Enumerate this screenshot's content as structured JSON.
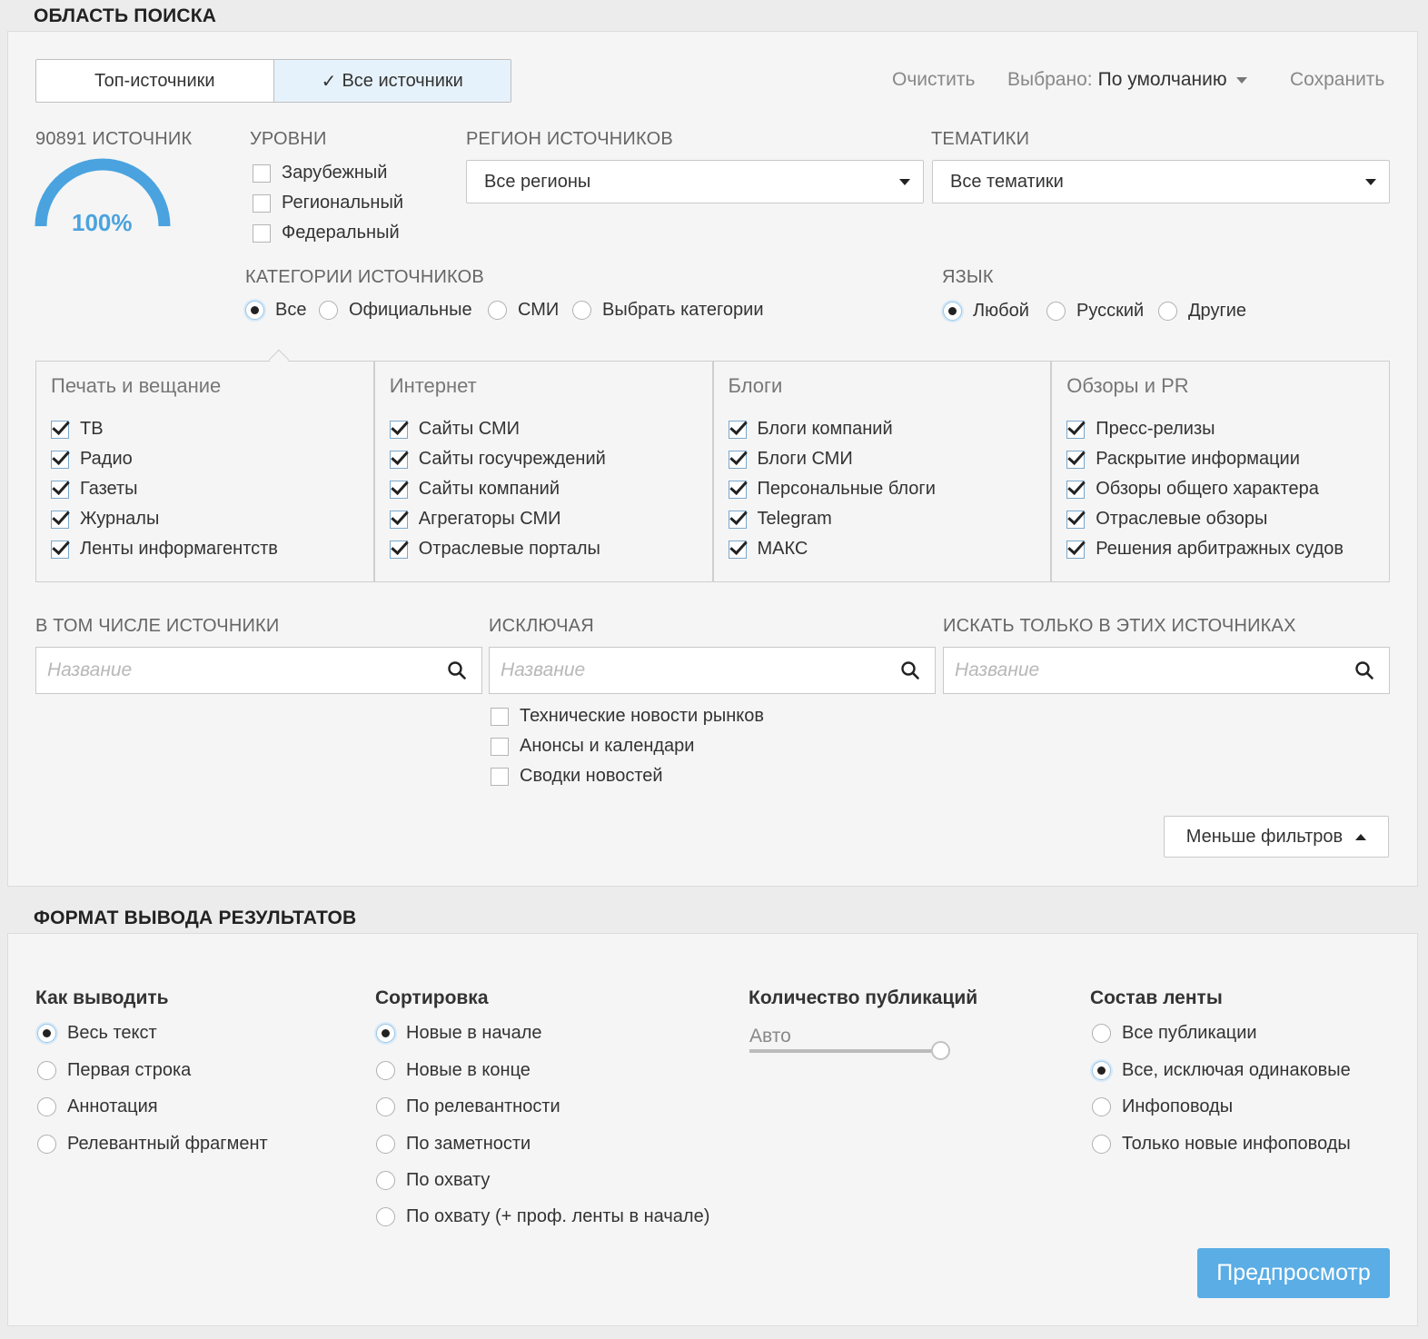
{
  "search_area": {
    "title": "ОБЛАСТЬ ПОИСКА",
    "segmented": {
      "top_sources": "Топ-источники",
      "all_sources": "Все источники"
    },
    "top_actions": {
      "clear": "Очистить",
      "selected_label": "Выбрано:",
      "selected_value": "По умолчанию",
      "save": "Сохранить"
    },
    "gauge": {
      "label": "90891 ИСТОЧНИК",
      "percent_text": "100%",
      "percent": 100,
      "color": "#4aa3df"
    },
    "levels": {
      "label": "УРОВНИ",
      "items": [
        "Зарубежный",
        "Региональный",
        "Федеральный"
      ]
    },
    "region": {
      "label": "РЕГИОН ИСТОЧНИКОВ",
      "value": "Все регионы"
    },
    "topics": {
      "label": "ТЕМАТИКИ",
      "value": "Все тематики"
    },
    "source_categories": {
      "label": "КАТЕГОРИИ ИСТОЧНИКОВ",
      "options": [
        "Все",
        "Официальные",
        "СМИ",
        "Выбрать категории"
      ],
      "selected": "Все"
    },
    "language": {
      "label": "ЯЗЫК",
      "options": [
        "Любой",
        "Русский",
        "Другие"
      ],
      "selected": "Любой"
    },
    "category_groups": [
      {
        "title": "Печать и вещание",
        "items": [
          "ТВ",
          "Радио",
          "Газеты",
          "Журналы",
          "Ленты информагентств"
        ]
      },
      {
        "title": "Интернет",
        "items": [
          "Сайты СМИ",
          "Сайты госучреждений",
          "Сайты компаний",
          "Агрегаторы СМИ",
          "Отраслевые порталы"
        ]
      },
      {
        "title": "Блоги",
        "items": [
          "Блоги компаний",
          "Блоги СМИ",
          "Персональные блоги",
          "Telegram",
          "МАКС"
        ]
      },
      {
        "title": "Обзоры и PR",
        "items": [
          "Пресс-релизы",
          "Раскрытие информации",
          "Обзоры общего характера",
          "Отраслевые обзоры",
          "Решения арбитражных судов"
        ]
      }
    ],
    "include_sources": {
      "label": "В ТОМ ЧИСЛЕ ИСТОЧНИКИ",
      "placeholder": "Название"
    },
    "exclude": {
      "label": "ИСКЛЮЧАЯ",
      "placeholder": "Название",
      "options": [
        "Технические новости рынков",
        "Анонсы и календари",
        "Сводки новостей"
      ]
    },
    "only_sources": {
      "label": "ИСКАТЬ ТОЛЬКО В ЭТИХ ИСТОЧНИКАХ",
      "placeholder": "Название"
    },
    "fewer_filters": "Меньше фильтров"
  },
  "output_format": {
    "title": "ФОРМАТ ВЫВОДА РЕЗУЛЬТАТОВ",
    "how": {
      "label": "Как выводить",
      "options": [
        "Весь текст",
        "Первая строка",
        "Аннотация",
        "Релевантный фрагмент"
      ],
      "selected": "Весь текст"
    },
    "sort": {
      "label": "Сортировка",
      "options": [
        "Новые в начале",
        "Новые в конце",
        "По релевантности",
        "По заметности",
        "По охвату",
        "По охвату (+ проф. ленты в начале)"
      ],
      "selected": "Новые в начале"
    },
    "count": {
      "label": "Количество публикаций",
      "value": "Авто",
      "slider_level": 1.0
    },
    "feed": {
      "label": "Состав ленты",
      "options": [
        "Все публикации",
        "Все, исключая одинаковые",
        "Инфоповоды",
        "Только новые инфоповоды"
      ],
      "selected": "Все, исключая одинаковые"
    },
    "preview": "Предпросмотр"
  },
  "colors": {
    "accent": "#5aade5",
    "panel": "#f5f5f5",
    "background": "#ececec"
  }
}
